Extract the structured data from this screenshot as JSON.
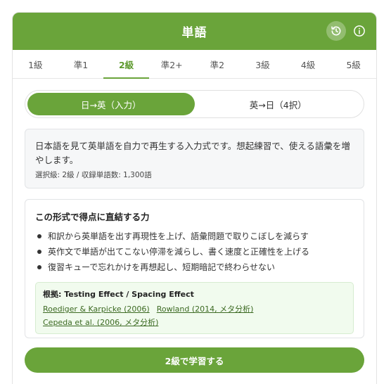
{
  "header": {
    "title": "単語",
    "history_icon": "history-icon",
    "info_icon": "info-icon",
    "accent_color": "#6aa43a"
  },
  "tabs": [
    {
      "label": "1級"
    },
    {
      "label": "準1"
    },
    {
      "label": "2級",
      "active": true
    },
    {
      "label": "準2+"
    },
    {
      "label": "準2"
    },
    {
      "label": "3級"
    },
    {
      "label": "4級"
    },
    {
      "label": "5級"
    }
  ],
  "mode": {
    "options": [
      {
        "label": "日→英（入力）",
        "active": true
      },
      {
        "label": "英→日（4択）"
      }
    ]
  },
  "description": {
    "text": "日本語を見て英単語を自力で再生する入力式です。想起練習で、使える語彙を増やします。",
    "meta": "選択級: 2級 / 収録単語数: 1,300語"
  },
  "power": {
    "title": "この形式で得点に直結する力",
    "bullets": [
      "和訳から英単語を出す再現性を上げ、語彙問題で取りこぼしを減らす",
      "英作文で単語が出てこない停滞を減らし、書く速度と正確性を上げる",
      "復習キューで忘れかけを再想起し、短期暗記で終わらせない"
    ],
    "evidence": {
      "title": "根拠: Testing Effect / Spacing Effect",
      "links": [
        "Roediger & Karpicke (2006)",
        "Rowland (2014, メタ分析)",
        "Cepeda et al. (2006, メタ分析)"
      ]
    }
  },
  "cta": {
    "label": "2級で学習する"
  }
}
